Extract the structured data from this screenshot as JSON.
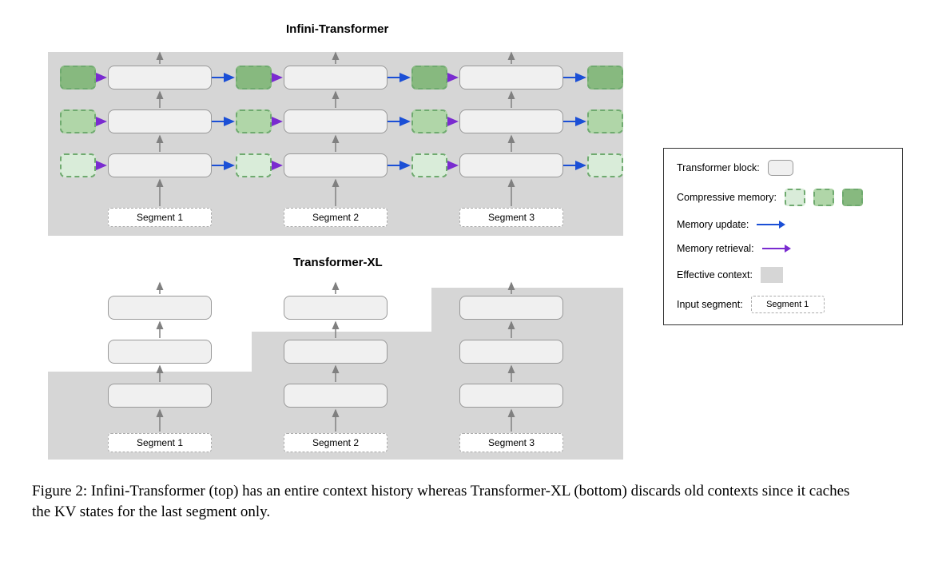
{
  "titles": {
    "top": "Infini-Transformer",
    "bottom": "Transformer-XL"
  },
  "segments": {
    "top": [
      "Segment 1",
      "Segment 2",
      "Segment 3"
    ],
    "bottom": [
      "Segment 1",
      "Segment 2",
      "Segment 3"
    ]
  },
  "legend": {
    "transformer_block": "Transformer block:",
    "compressive_memory": "Compressive memory:",
    "memory_update": "Memory update:",
    "memory_retrieval": "Memory retrieval:",
    "effective_context": "Effective context:",
    "input_segment": "Input segment:",
    "input_segment_example": "Segment 1"
  },
  "caption": "Figure 2: Infini-Transformer (top) has an entire context history whereas Transformer-XL (bottom) discards old contexts since it caches the KV states for the last segment only.",
  "colors": {
    "memory_update": "#1b4fd6",
    "memory_retrieval": "#7a2bd0",
    "vertical_arrow": "#808080"
  }
}
